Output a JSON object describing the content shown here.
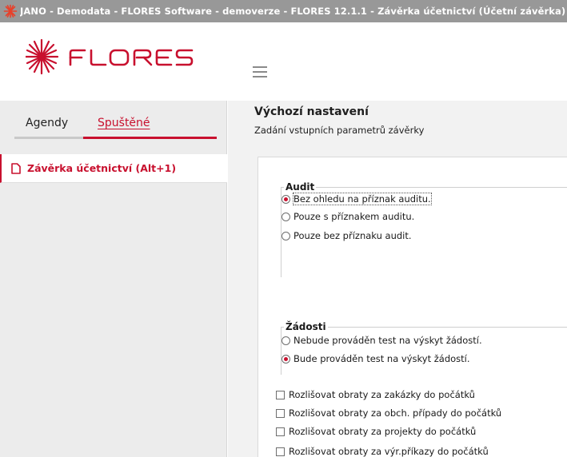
{
  "window": {
    "title": "JANO - Demodata - FLORES Software - demoverze - FLORES 12.1.1 - Závěrka účetnictví  (Účetní závěrka)",
    "logo_text": "FLORES",
    "brand_color": "#c8102e"
  },
  "header": {
    "menu_icon": "hamburger-menu-icon"
  },
  "sidebar": {
    "tabs": [
      {
        "label": "Agendy",
        "active": false
      },
      {
        "label": "Spuštěné",
        "active": true
      }
    ],
    "items": [
      {
        "label": "Závěrka účetnictví (Alt+1)",
        "icon": "document-icon",
        "active": true
      }
    ]
  },
  "main": {
    "title": "Výchozí nastavení",
    "subtitle": "Zadání vstupních parametrů závěrky",
    "audit": {
      "legend": "Audit",
      "options": [
        {
          "label": "Bez ohledu na příznak auditu.",
          "selected": true
        },
        {
          "label": "Pouze s příznakem auditu.",
          "selected": false
        },
        {
          "label": "Pouze bez příznaku audit.",
          "selected": false
        }
      ]
    },
    "zadosti": {
      "legend": "Žádosti",
      "options": [
        {
          "label": "Nebude prováděn test na výskyt žádostí.",
          "selected": false
        },
        {
          "label": "Bude prováděn test na výskyt žádostí.",
          "selected": true
        }
      ]
    },
    "checkboxes": [
      {
        "label": "Rozlišovat obraty za zakázky do počátků",
        "checked": false
      },
      {
        "label": "Rozlišovat obraty za obch. případy do počátků",
        "checked": false
      },
      {
        "label": "Rozlišovat obraty za projekty do počátků",
        "checked": false
      },
      {
        "label": "Rozlišovat obraty za výr.příkazy do počátků",
        "checked": false
      }
    ]
  }
}
